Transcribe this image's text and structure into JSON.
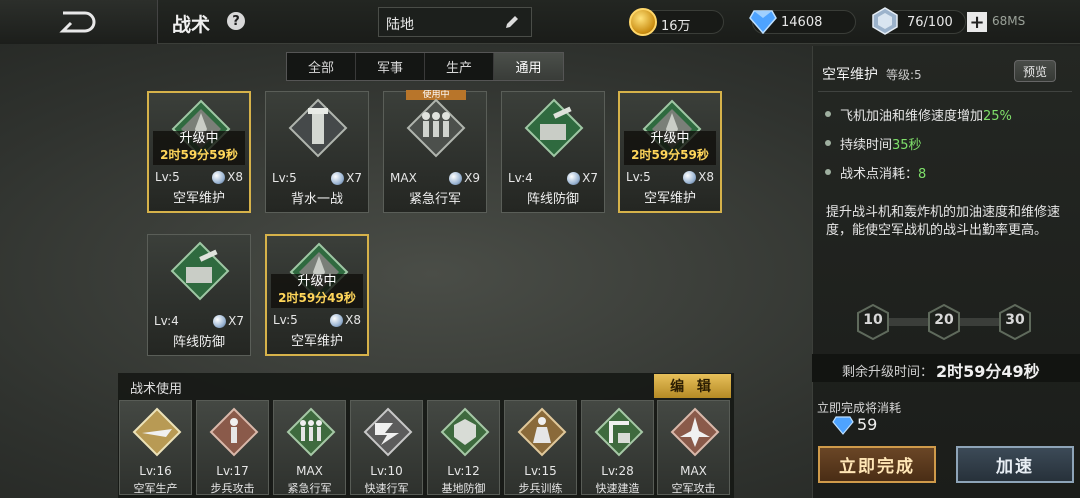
{
  "header": {
    "title": "战术",
    "help": "?",
    "mode": "陆地",
    "gold": "16万",
    "diamonds": "14608",
    "stamina": "76/100",
    "net_speed": "68MS"
  },
  "tabs": [
    {
      "label": "全部",
      "active": false
    },
    {
      "label": "军事",
      "active": false
    },
    {
      "label": "生产",
      "active": false
    },
    {
      "label": "通用",
      "active": true
    }
  ],
  "cards": [
    {
      "name": "空军维护",
      "level": "Lv:5",
      "count": "X8",
      "upgrading": true,
      "upg_label": "升级中",
      "upg_time": "2时59分59秒",
      "icon": "plane-icon"
    },
    {
      "name": "背水一战",
      "level": "Lv:5",
      "count": "X7",
      "upgrading": false,
      "icon": "tower-icon"
    },
    {
      "name": "紧急行军",
      "level": "MAX",
      "count": "X9",
      "upgrading": false,
      "in_use": "使用中",
      "icon": "march-icon"
    },
    {
      "name": "阵线防御",
      "level": "Lv:4",
      "count": "X7",
      "upgrading": false,
      "icon": "turret-icon"
    },
    {
      "name": "空军维护",
      "level": "Lv:5",
      "count": "X8",
      "upgrading": true,
      "upg_label": "升级中",
      "upg_time": "2时59分59秒",
      "icon": "plane-icon"
    },
    {
      "name": "阵线防御",
      "level": "Lv:4",
      "count": "X7",
      "upgrading": false,
      "icon": "turret-icon"
    },
    {
      "name": "空军维护",
      "level": "Lv:5",
      "count": "X8",
      "upgrading": true,
      "upg_label": "升级中",
      "upg_time": "2时59分49秒",
      "icon": "plane-icon"
    }
  ],
  "usage": {
    "title": "战术使用",
    "edit": "编 辑",
    "slots": [
      {
        "name": "空军生产",
        "level": "Lv:16",
        "color": "#b89a54"
      },
      {
        "name": "步兵攻击",
        "level": "Lv:17",
        "color": "#8a5a4a"
      },
      {
        "name": "紧急行军",
        "level": "MAX",
        "color": "#3e6a3e"
      },
      {
        "name": "快速行军",
        "level": "Lv:10",
        "color": "#5c5c5c"
      },
      {
        "name": "基地防御",
        "level": "Lv:12",
        "color": "#3e6a3e"
      },
      {
        "name": "步兵训练",
        "level": "Lv:15",
        "color": "#8a6a3a"
      },
      {
        "name": "快速建造",
        "level": "Lv:28",
        "color": "#3e6a3e"
      },
      {
        "name": "空军攻击",
        "level": "MAX",
        "color": "#8a5a4a"
      }
    ]
  },
  "detail": {
    "name": "空军维护",
    "level": "等级:5",
    "preview": "预览",
    "effects": [
      {
        "text": "飞机加油和维修速度增加",
        "value": "25%"
      },
      {
        "text": "持续时间",
        "value": "35秒"
      },
      {
        "text": "战术点消耗：",
        "value": "8"
      }
    ],
    "description": "提升战斗机和轰炸机的加油速度和维修速度，能使空军战机的战斗出勤率更高。",
    "milestones": [
      "10",
      "20",
      "30"
    ],
    "remain_label": "剩余升级时间：",
    "remain_time": "2时59分49秒",
    "instant_label": "立即完成将消耗",
    "instant_cost": "59",
    "btn_instant": "立即完成",
    "btn_speed": "加速"
  }
}
